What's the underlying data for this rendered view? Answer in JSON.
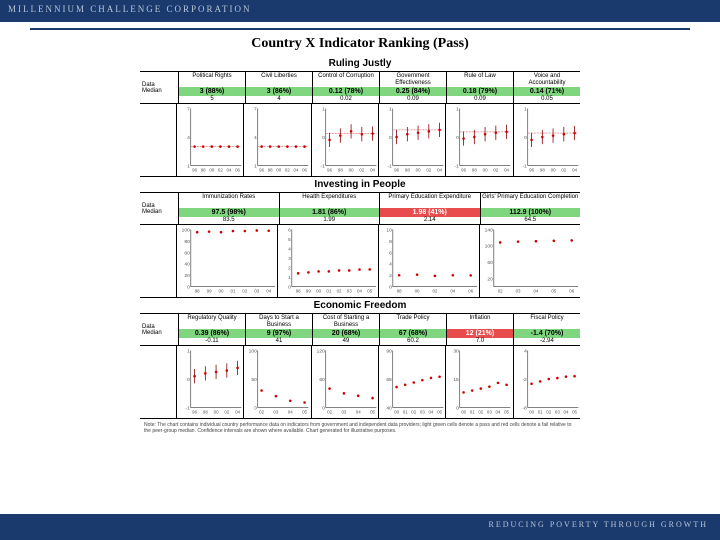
{
  "header": {
    "org": "MILLENNIUM CHALLENGE CORPORATION"
  },
  "title": "Country X Indicator Ranking (Pass)",
  "footer": {
    "tagline": "REDUCING POVERTY THROUGH GROWTH"
  },
  "footnote": "Note: The chart contains individual country performance data on indicators from government and independent data providers; light green cells denote a pass and red cells denote a fail relative to the peer-group median. Confidence intervals are shown where available. Chart generated for illustrative purposes.",
  "sections": [
    {
      "title": "Ruling Justly",
      "lead_top": "Data",
      "lead_bot": "Median",
      "cols": 6,
      "indicators": [
        {
          "name": "Political Rights",
          "val": "3 (88%)",
          "med": "5",
          "pass": true
        },
        {
          "name": "Civil Liberties",
          "val": "3 (86%)",
          "med": "4",
          "pass": true
        },
        {
          "name": "Control of Corruption",
          "val": "0.12 (78%)",
          "med": "0.02",
          "pass": true
        },
        {
          "name": "Government Effectiveness",
          "val": "0.25 (84%)",
          "med": "0.09",
          "pass": true
        },
        {
          "name": "Rule of Law",
          "val": "0.18 (79%)",
          "med": "0.09",
          "pass": true
        },
        {
          "name": "Voice and Accountability",
          "val": "0.14 (71%)",
          "med": "0.05",
          "pass": true
        }
      ],
      "chart_data": [
        {
          "type": "scatter",
          "ylim": [
            1,
            7
          ],
          "x": [
            "96",
            "98",
            "00",
            "02",
            "04",
            "06"
          ],
          "values": [
            3,
            3,
            3,
            3,
            3,
            3
          ],
          "highlight_y": 3
        },
        {
          "type": "scatter",
          "ylim": [
            1,
            7
          ],
          "x": [
            "96",
            "98",
            "00",
            "02",
            "04",
            "06"
          ],
          "values": [
            3,
            3,
            3,
            3,
            3,
            3
          ],
          "highlight_y": 3
        },
        {
          "type": "scatter",
          "ylim": [
            -1,
            1
          ],
          "x": [
            "96",
            "98",
            "00",
            "02",
            "04"
          ],
          "values": [
            -0.1,
            0.05,
            0.2,
            0.1,
            0.12
          ],
          "err": 0.25,
          "highlight_y": 0.12
        },
        {
          "type": "scatter",
          "ylim": [
            -1,
            1
          ],
          "x": [
            "96",
            "98",
            "00",
            "02",
            "04"
          ],
          "values": [
            0.0,
            0.1,
            0.15,
            0.2,
            0.25
          ],
          "err": 0.25,
          "highlight_y": 0.25
        },
        {
          "type": "scatter",
          "ylim": [
            -1,
            1
          ],
          "x": [
            "96",
            "98",
            "00",
            "02",
            "04"
          ],
          "values": [
            -0.05,
            0.0,
            0.1,
            0.15,
            0.18
          ],
          "err": 0.25,
          "highlight_y": 0.18
        },
        {
          "type": "scatter",
          "ylim": [
            -1,
            1
          ],
          "x": [
            "96",
            "98",
            "00",
            "02",
            "04"
          ],
          "values": [
            -0.1,
            0.0,
            0.05,
            0.1,
            0.14
          ],
          "err": 0.25,
          "highlight_y": 0.14
        }
      ]
    },
    {
      "title": "Investing in People",
      "lead_top": "Data",
      "lead_bot": "Median",
      "cols": 4,
      "indicators": [
        {
          "name": "Immunization Rates",
          "val": "97.5 (98%)",
          "med": "83.5",
          "pass": true
        },
        {
          "name": "Health Expenditures",
          "val": "1.81 (86%)",
          "med": "1.99",
          "pass": true
        },
        {
          "name": "Primary Education Expenditure",
          "val": "1.98 (41%)",
          "med": "2.14",
          "pass": false
        },
        {
          "name": "Girls' Primary Education Completion",
          "val": "112.9 (100%)",
          "med": "64.5",
          "pass": true
        }
      ],
      "chart_data": [
        {
          "type": "scatter",
          "ylim": [
            0,
            100
          ],
          "x": [
            "98",
            "99",
            "00",
            "01",
            "02",
            "03",
            "04"
          ],
          "values": [
            95,
            96,
            95,
            97,
            97,
            98,
            97.5
          ],
          "yticks": [
            0,
            20,
            40,
            60,
            80,
            100
          ]
        },
        {
          "type": "scatter",
          "ylim": [
            0,
            6
          ],
          "x": [
            "98",
            "99",
            "00",
            "01",
            "02",
            "03",
            "04",
            "05"
          ],
          "values": [
            1.4,
            1.5,
            1.6,
            1.6,
            1.7,
            1.7,
            1.8,
            1.81
          ],
          "yticks": [
            0,
            1,
            2,
            3,
            4,
            5,
            6
          ]
        },
        {
          "type": "scatter",
          "ylim": [
            0,
            10
          ],
          "x": [
            "98",
            "00",
            "02",
            "04",
            "06"
          ],
          "values": [
            2.0,
            2.1,
            1.9,
            2.0,
            1.98
          ],
          "yticks": [
            0,
            2,
            4,
            6,
            8,
            10
          ]
        },
        {
          "type": "scatter",
          "ylim": [
            0,
            140
          ],
          "x": [
            "02",
            "03",
            "04",
            "05",
            "06"
          ],
          "values": [
            108,
            110,
            111,
            112,
            112.9
          ],
          "yticks": [
            20,
            60,
            100,
            140
          ]
        }
      ]
    },
    {
      "title": "Economic Freedom",
      "lead_top": "Data",
      "lead_bot": "Median",
      "cols": 6,
      "indicators": [
        {
          "name": "Regulatory Quality",
          "val": "0.39 (86%)",
          "med": "-0.11",
          "pass": true
        },
        {
          "name": "Days to Start a Business",
          "val": "9 (97%)",
          "med": "41",
          "pass": true
        },
        {
          "name": "Cost of Starting a Business",
          "val": "20 (68%)",
          "med": "49",
          "pass": true
        },
        {
          "name": "Trade Policy",
          "val": "67 (68%)",
          "med": "60.2",
          "pass": true
        },
        {
          "name": "Inflation",
          "val": "12 (21%)",
          "med": "7.0",
          "pass": false
        },
        {
          "name": "Fiscal Policy",
          "val": "-1.4 (70%)",
          "med": "-2.94",
          "pass": true
        }
      ],
      "chart_data": [
        {
          "type": "scatter",
          "ylim": [
            -1,
            1
          ],
          "x": [
            "96",
            "98",
            "00",
            "02",
            "04"
          ],
          "values": [
            0.1,
            0.2,
            0.25,
            0.3,
            0.39
          ],
          "err": 0.25
        },
        {
          "type": "scatter",
          "ylim": [
            0,
            100
          ],
          "x": [
            "02",
            "03",
            "04",
            "05"
          ],
          "values": [
            30,
            20,
            12,
            9
          ]
        },
        {
          "type": "scatter",
          "ylim": [
            0,
            120
          ],
          "x": [
            "02",
            "03",
            "04",
            "05"
          ],
          "values": [
            40,
            30,
            25,
            20
          ]
        },
        {
          "type": "scatter",
          "ylim": [
            40,
            90
          ],
          "x": [
            "00",
            "01",
            "02",
            "03",
            "04",
            "05"
          ],
          "values": [
            58,
            60,
            62,
            64,
            66,
            67
          ]
        },
        {
          "type": "scatter",
          "ylim": [
            0,
            30
          ],
          "x": [
            "00",
            "01",
            "02",
            "03",
            "04",
            "05"
          ],
          "values": [
            8,
            9,
            10,
            11,
            13,
            12
          ]
        },
        {
          "type": "scatter",
          "ylim": [
            -8,
            4
          ],
          "x": [
            "00",
            "01",
            "02",
            "03",
            "04",
            "05"
          ],
          "values": [
            -3,
            -2.5,
            -2,
            -1.8,
            -1.5,
            -1.4
          ]
        }
      ]
    }
  ]
}
